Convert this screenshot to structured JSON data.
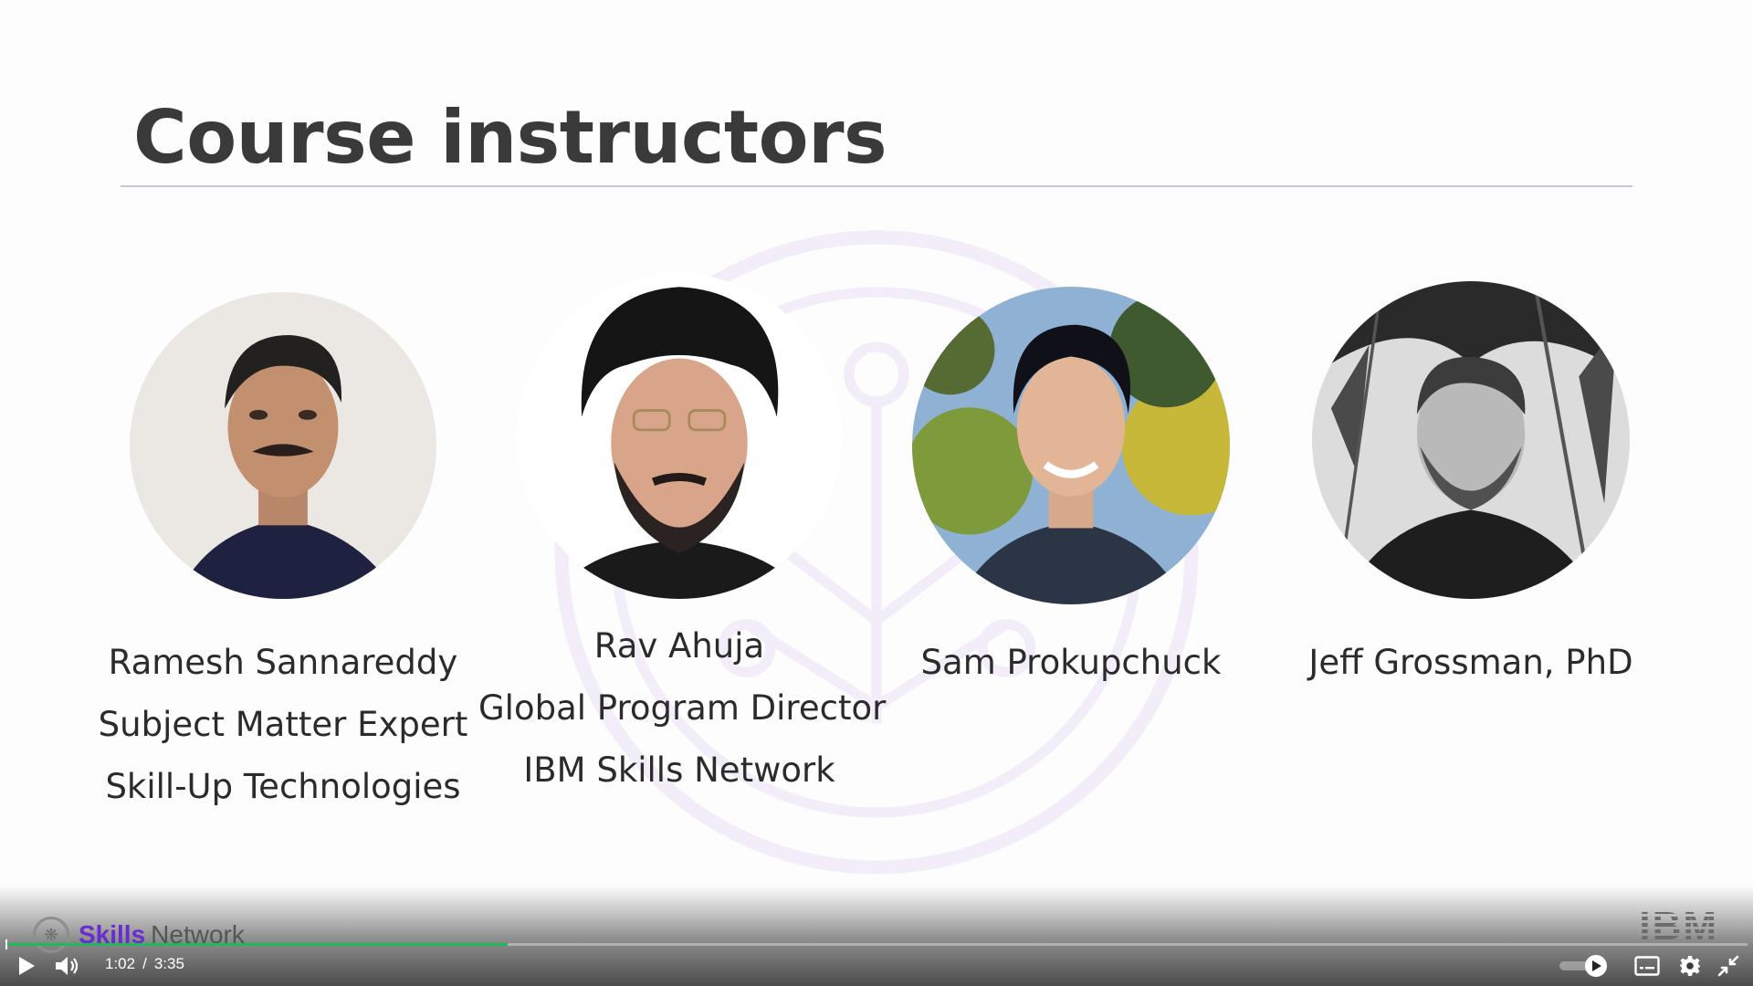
{
  "slide": {
    "title": "Course instructors"
  },
  "instructors": [
    {
      "name": "Ramesh Sannareddy",
      "role": "Subject Matter Expert",
      "org": "Skill-Up Technologies"
    },
    {
      "name": "Rav Ahuja",
      "role": "Global Program Director",
      "org": "IBM Skills Network"
    },
    {
      "name": "Sam Prokupchuck",
      "role": "",
      "org": ""
    },
    {
      "name": "Jeff Grossman, PhD",
      "role": "",
      "org": ""
    }
  ],
  "branding": {
    "skills": "Skills",
    "network": "Network",
    "ibm": "IBM",
    "accent_color": "#6a2bd0"
  },
  "player": {
    "current_time": "1:02",
    "separator": "/",
    "duration": "3:35",
    "progress_fraction": 0.288,
    "progress_color": "#1fb85a",
    "icons": [
      "play-icon",
      "volume-icon",
      "speed-toggle-icon",
      "closed-captions-icon",
      "gear-icon",
      "exit-fullscreen-icon"
    ]
  }
}
